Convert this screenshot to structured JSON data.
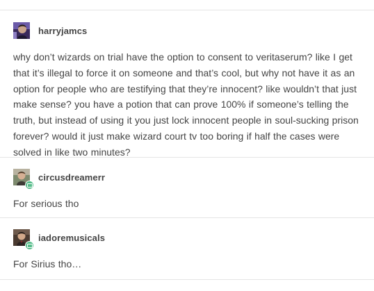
{
  "posts": [
    {
      "username": "harryjamcs",
      "avatar": "purple-portrait-avatar",
      "text": "why don’t wizards on trial have the option to consent to veritaserum? like I get that it’s illegal to force it on someone and that’s cool, but why not have it as an option for people who are testifying that they’re innocent? like wouldn’t that just make sense? you have a potion that can prove 100% if someone’s telling the truth, but instead of using it you just lock innocent people in soul-sucking prison forever? would it just make wizard court tv too boring if half the cases were solved in like two minutes?"
    },
    {
      "username": "circusdreamerr",
      "avatar": "portrait-avatar",
      "badge": "green-badge-icon",
      "text": "For serious tho"
    },
    {
      "username": "iadoremusicals",
      "avatar": "portrait-avatar",
      "badge": "green-badge-icon",
      "text": "For Sirius tho…"
    }
  ],
  "colors": {
    "text": "#444444",
    "divider": "#e4e4e4",
    "badge": "#56bc8a"
  }
}
